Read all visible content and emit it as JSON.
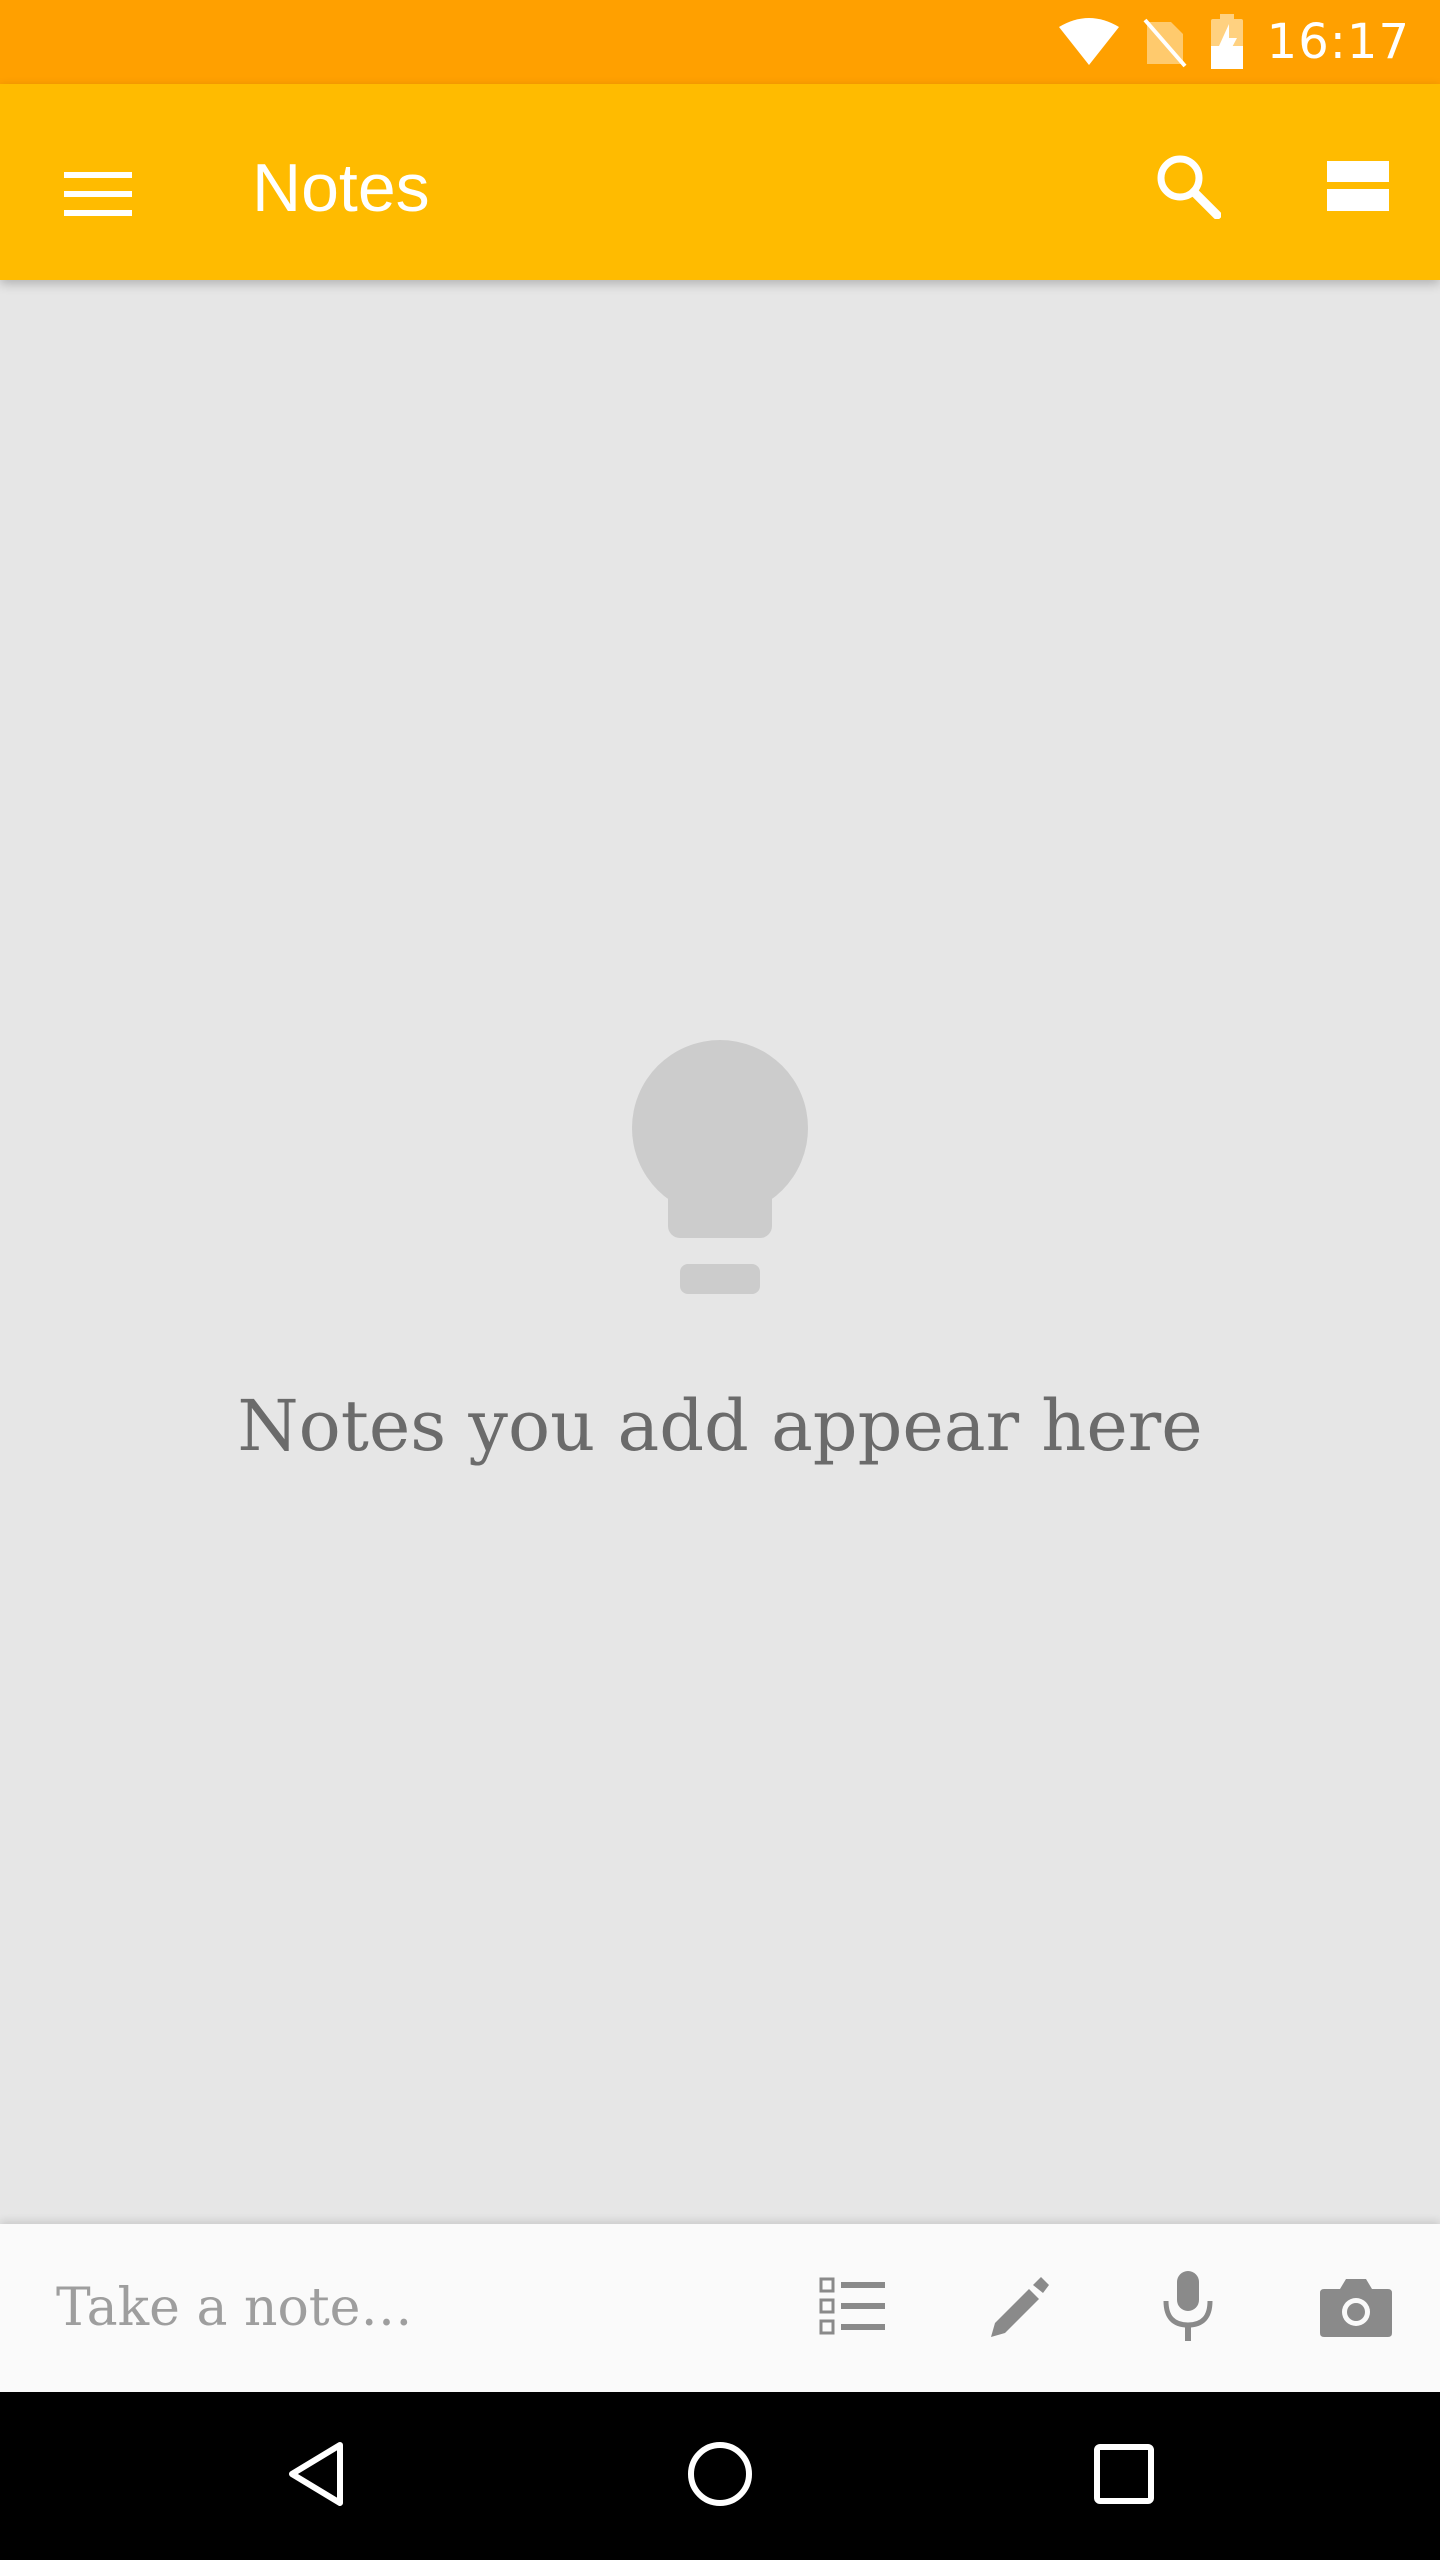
{
  "status_bar": {
    "time": "16:17",
    "icons": [
      "wifi-icon",
      "no-sim-icon",
      "battery-charging-icon"
    ]
  },
  "app_bar": {
    "title": "Notes",
    "icons": [
      "menu-icon",
      "search-icon",
      "view-toggle-icon"
    ]
  },
  "main": {
    "empty_icon": "lightbulb-icon",
    "empty_message": "Notes you add appear here"
  },
  "bottom_bar": {
    "placeholder": "Take a note…",
    "icons": [
      "checklist-icon",
      "pen-icon",
      "microphone-icon",
      "camera-icon"
    ]
  },
  "nav_bar": {
    "icons": [
      "back-icon",
      "home-icon",
      "recents-icon"
    ]
  },
  "colors": {
    "status_bar": "#ffa000",
    "app_bar": "#ffbb00",
    "background": "#e6e6e6",
    "bottom_bar": "#fafafa",
    "nav_bar": "#000000"
  }
}
